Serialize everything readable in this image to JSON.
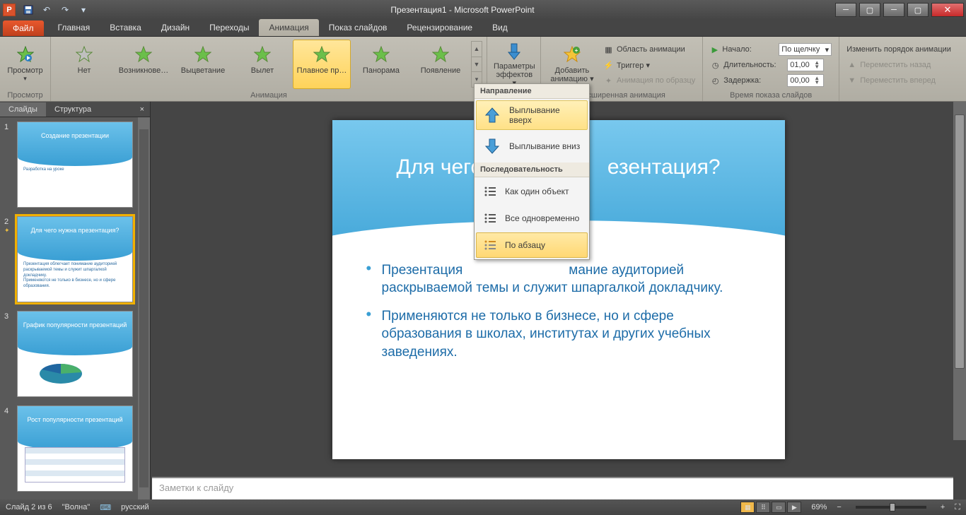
{
  "app": {
    "title": "Презентация1 - Microsoft PowerPoint",
    "icon_letter": "P"
  },
  "qat": {
    "save": "save",
    "undo": "undo",
    "redo": "redo",
    "dropdown": "▾"
  },
  "win": {
    "min": "─",
    "max": "▢",
    "close": "✕",
    "min2": "─",
    "max2": "▢"
  },
  "tabs": {
    "file": "Файл",
    "items": [
      "Главная",
      "Вставка",
      "Дизайн",
      "Переходы",
      "Анимация",
      "Показ слайдов",
      "Рецензирование",
      "Вид"
    ],
    "active_index": 4
  },
  "ribbon": {
    "preview": {
      "label": "Просмотр",
      "group": "Просмотр"
    },
    "effects": {
      "group": "Анимация",
      "items": [
        "Нет",
        "Возникнове…",
        "Выцветание",
        "Вылет",
        "Плавное пр…",
        "Панорама",
        "Появление"
      ],
      "selected_index": 4
    },
    "effect_options": {
      "label": "Параметры\nэффектов ▾"
    },
    "add_anim": {
      "label": "Добавить\nанимацию ▾",
      "group": "Расширенная анимация",
      "pane": "Область анимации",
      "trigger": "Триггер ▾",
      "painter": "Анимация по образцу"
    },
    "timing": {
      "group": "Время показа слайдов",
      "start_lbl": "Начало:",
      "start_val": "По щелчку",
      "dur_lbl": "Длительность:",
      "dur_val": "01,00",
      "delay_lbl": "Задержка:",
      "delay_val": "00,00"
    },
    "reorder": {
      "title": "Изменить порядок анимации",
      "back": "Переместить назад",
      "fwd": "Переместить вперед"
    }
  },
  "dropdown": {
    "section1": "Направление",
    "item1": "Выплывание вверх",
    "item2": "Выплывание вниз",
    "section2": "Последовательность",
    "item3": "Как один объект",
    "item4": "Все одновременно",
    "item5": "По абзацу"
  },
  "leftpanel": {
    "tab_slides": "Слайды",
    "tab_outline": "Структура",
    "close": "×",
    "thumbs": [
      {
        "num": "1",
        "title": "Создание презентации",
        "body": "Разработка на уроке"
      },
      {
        "num": "2",
        "title": "Для чего нужна презентация?",
        "body": "Презентация облегчает понимание аудиторией раскрываемой темы и служит шпаргалкой докладчику.\nПрименяются не только в бизнесе, но и сфере образования."
      },
      {
        "num": "3",
        "title": "График популярности презентаций",
        "body": ""
      },
      {
        "num": "4",
        "title": "Рост популярности презентаций",
        "body": ""
      }
    ],
    "active_index": 1,
    "anim_marker": "✦"
  },
  "slide": {
    "title": "Для чего нужна презентация?",
    "title_left": "Для чего",
    "title_right": "езентация?",
    "bullets": [
      "Презентация облегчает понимание аудиторией раскрываемой темы и служит шпаргалкой докладчику.",
      "Применяются не только в бизнесе, но и сфере образования в школах, институтах и других учебных заведениях."
    ],
    "bullet1_a": "Презентация",
    "bullet1_b": "мание аудиторией раскрываемой темы и служит шпаргалкой докладчику.",
    "bullet2": "Применяются не только в бизнесе, но и сфере образования в школах, институтах и других учебных заведениях."
  },
  "notes": {
    "placeholder": "Заметки к слайду"
  },
  "status": {
    "slide_of": "Слайд 2 из 6",
    "theme": "\"Волна\"",
    "lang": "русский",
    "zoom": "69%"
  },
  "colors": {
    "accent": "#f0b000",
    "wave1": "#78c8ee",
    "wave2": "#42a6d8",
    "text_blue": "#1d6ca8"
  }
}
